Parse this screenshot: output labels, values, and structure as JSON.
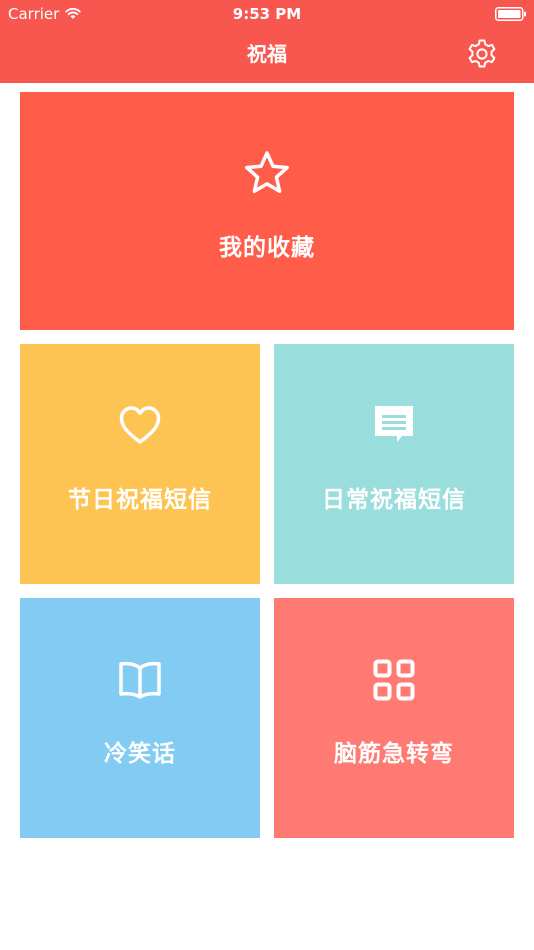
{
  "status_bar": {
    "carrier": "Carrier",
    "time": "9:53 PM",
    "wifi_icon": "wifi-icon",
    "battery_icon": "battery-icon"
  },
  "nav": {
    "title": "祝福",
    "settings_icon": "gear-icon"
  },
  "tiles": [
    {
      "label": "我的收藏",
      "icon": "star-icon",
      "color": "#ff5c4a"
    },
    {
      "label": "节日祝福短信",
      "icon": "heart-icon",
      "color": "#fdc453"
    },
    {
      "label": "日常祝福短信",
      "icon": "message-icon",
      "color": "#99dedc"
    },
    {
      "label": "冷笑话",
      "icon": "book-icon",
      "color": "#82cbf2"
    },
    {
      "label": "脑筋急转弯",
      "icon": "grid-icon",
      "color": "#ff7a72"
    }
  ],
  "colors": {
    "header": "#f7574f",
    "background": "#ffffff",
    "text": "#ffffff"
  }
}
